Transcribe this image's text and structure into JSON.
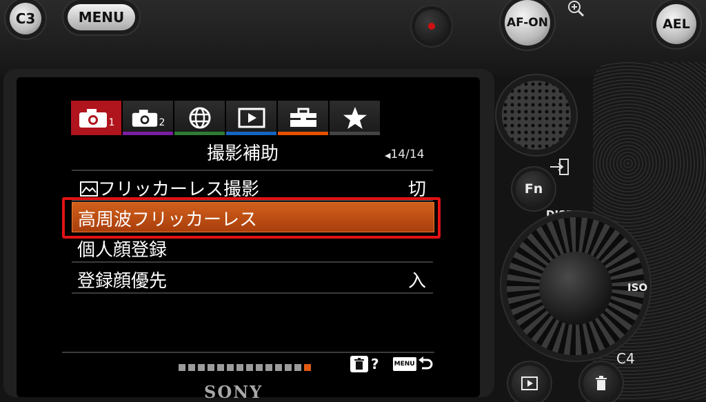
{
  "camera": {
    "buttons": {
      "c3": "C3",
      "menu": "MENU",
      "af_on": "AF-ON",
      "ael": "AEL",
      "fn": "Fn",
      "c4": "C4"
    },
    "labels": {
      "disp": "DISP",
      "iso": "ISO",
      "brand": "SONY"
    }
  },
  "menu": {
    "tabs": [
      {
        "icon": "camera-1-icon",
        "num": "1",
        "color": "#b0141d"
      },
      {
        "icon": "camera-2-icon",
        "num": "2",
        "color": "#7b1fa2"
      },
      {
        "icon": "globe-icon",
        "num": "",
        "color": "#2e7d32"
      },
      {
        "icon": "playback-icon",
        "num": "",
        "color": "#1565c0"
      },
      {
        "icon": "toolbox-icon",
        "num": "",
        "color": "#e65100"
      },
      {
        "icon": "star-icon",
        "num": "",
        "color": "#444444"
      }
    ],
    "title": "撮影補助",
    "page": "14/14",
    "items": [
      {
        "label": "フリッカーレス撮影",
        "value": "切"
      },
      {
        "label": "高周波フリッカーレス",
        "value": ""
      },
      {
        "label": "個人顔登録",
        "value": ""
      },
      {
        "label": "登録顔優先",
        "value": "入"
      }
    ],
    "selected_index": 1,
    "scroll_total": 14,
    "scroll_current": 14,
    "footer": {
      "help": "?",
      "menu": "MENU"
    }
  }
}
